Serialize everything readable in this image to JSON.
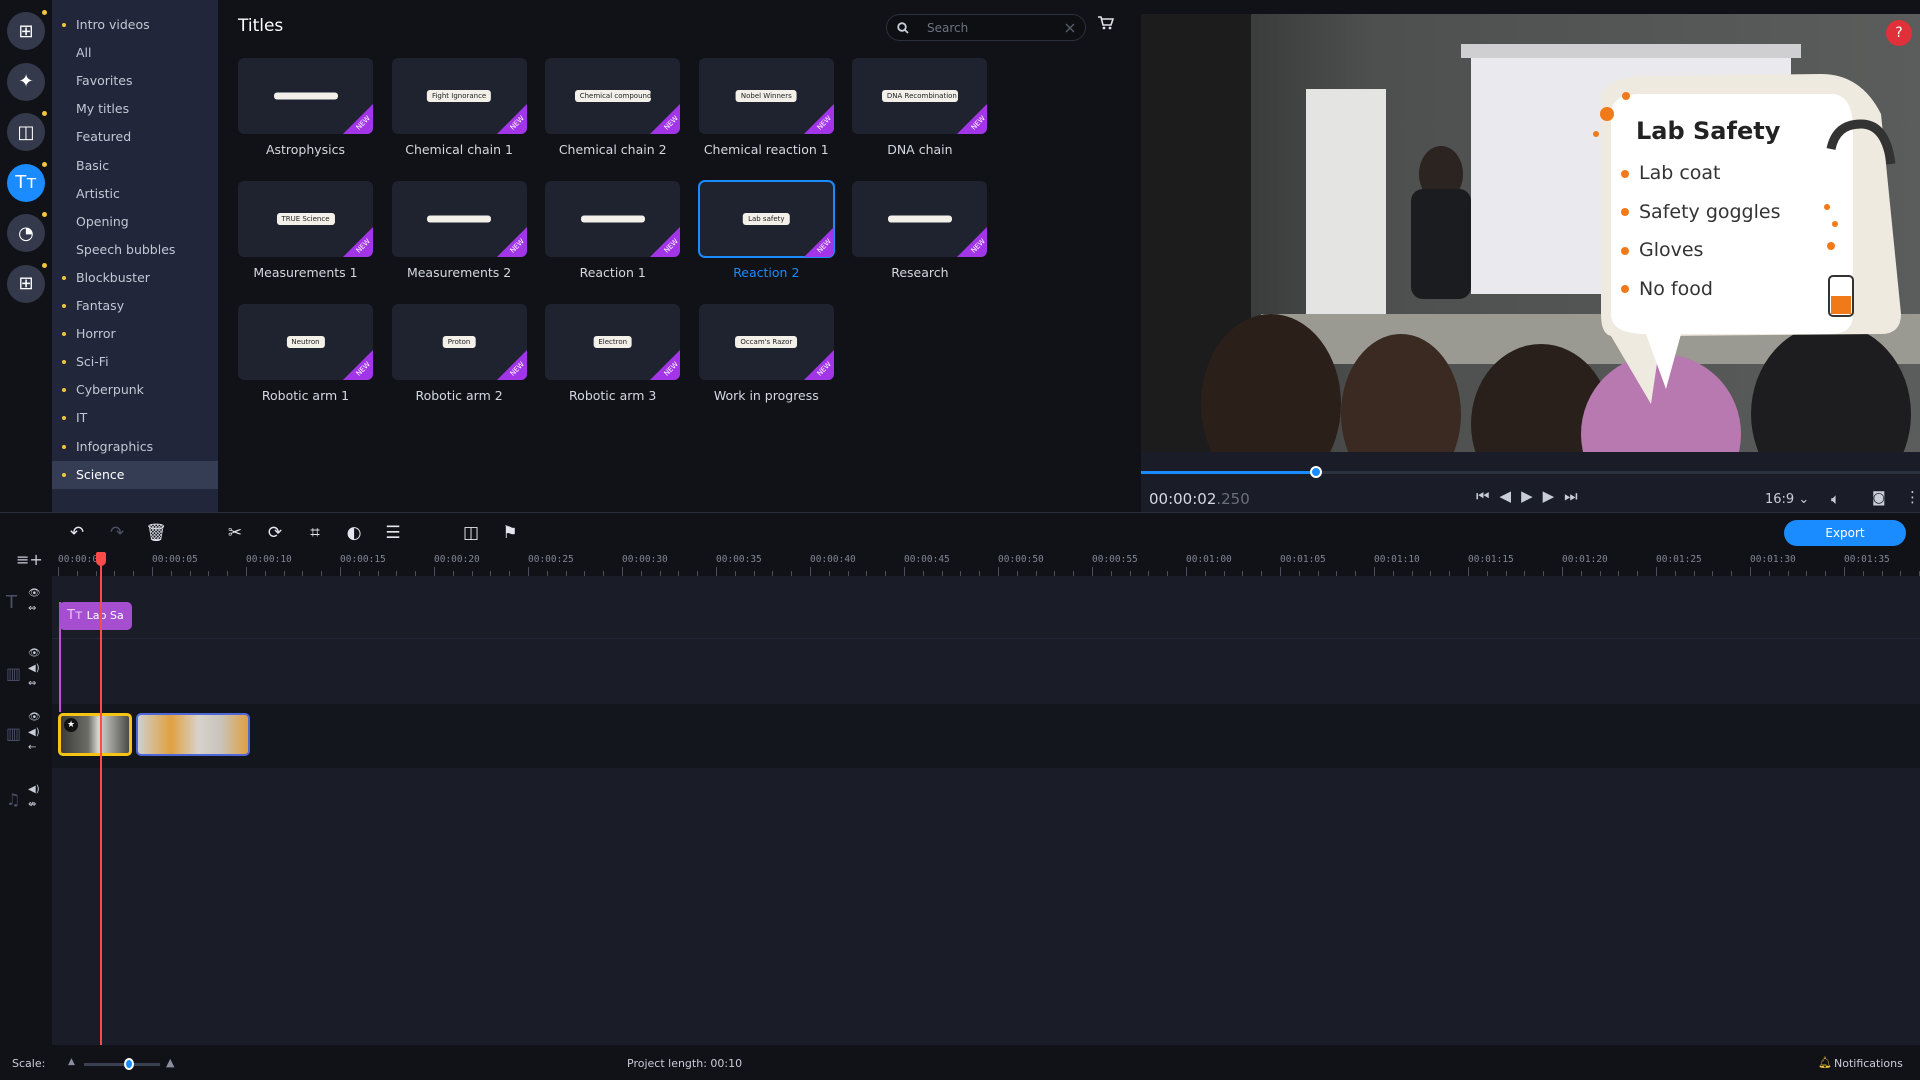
{
  "rail": [
    {
      "icon": "import-icon",
      "glyph": "⊞",
      "dot": true
    },
    {
      "icon": "magic-wand-icon",
      "glyph": "✦",
      "dot": false
    },
    {
      "icon": "transitions-icon",
      "glyph": "◫",
      "dot": true
    },
    {
      "icon": "titles-icon",
      "glyph": "Tт",
      "dot": true,
      "active": true
    },
    {
      "icon": "stickers-icon",
      "glyph": "◔",
      "dot": true
    },
    {
      "icon": "more-tools-icon",
      "glyph": "⊞",
      "dot": true
    }
  ],
  "categories": [
    {
      "label": "Intro videos",
      "dot": true
    },
    {
      "label": "All"
    },
    {
      "label": "Favorites"
    },
    {
      "label": "My titles"
    },
    {
      "label": "Featured"
    },
    {
      "label": "Basic"
    },
    {
      "label": "Artistic"
    },
    {
      "label": "Opening"
    },
    {
      "label": "Speech bubbles"
    },
    {
      "label": "Blockbuster",
      "dot": true
    },
    {
      "label": "Fantasy",
      "dot": true
    },
    {
      "label": "Horror",
      "dot": true
    },
    {
      "label": "Sci-Fi",
      "dot": true
    },
    {
      "label": "Cyberpunk",
      "dot": true
    },
    {
      "label": "IT",
      "dot": true
    },
    {
      "label": "Infographics",
      "dot": true
    },
    {
      "label": "Science",
      "dot": true,
      "selected": true
    }
  ],
  "panel": {
    "title": "Titles",
    "search_placeholder": "Search",
    "badge": "NEW"
  },
  "titles": [
    {
      "name": "Astrophysics",
      "thumb": "",
      "new": true
    },
    {
      "name": "Chemical chain 1",
      "thumb": "Fight Ignorance",
      "new": true
    },
    {
      "name": "Chemical chain 2",
      "thumb": "Chemical compounds",
      "new": true
    },
    {
      "name": "Chemical reaction 1",
      "thumb": "Nobel Winners",
      "new": true
    },
    {
      "name": "DNA chain",
      "thumb": "DNA Recombination",
      "new": true
    },
    {
      "name": "Measurements 1",
      "thumb": "TRUE Science",
      "new": true
    },
    {
      "name": "Measurements 2",
      "thumb": "",
      "new": true
    },
    {
      "name": "Reaction 1",
      "thumb": "",
      "new": true
    },
    {
      "name": "Reaction 2",
      "thumb": "Lab safety",
      "new": true,
      "selected": true
    },
    {
      "name": "Research",
      "thumb": "",
      "new": true
    },
    {
      "name": "Robotic arm 1",
      "thumb": "Neutron",
      "new": true
    },
    {
      "name": "Robotic arm 2",
      "thumb": "Proton",
      "new": true
    },
    {
      "name": "Robotic arm 3",
      "thumb": "Electron",
      "new": true
    },
    {
      "name": "Work in progress",
      "thumb": "Occam's Razor",
      "new": true
    }
  ],
  "preview": {
    "overlay_title": "Lab Safety",
    "items": [
      "Lab coat",
      "Safety goggles",
      "Gloves",
      "No food"
    ],
    "help": "?"
  },
  "player": {
    "time_main": "00:00:02",
    "time_ms": ".250",
    "progress": 0.225,
    "aspect": "16:9"
  },
  "toolbar": {
    "export_label": "Export"
  },
  "ruler": [
    "00:00:00",
    "00:00:05",
    "00:00:10",
    "00:00:15",
    "00:00:20",
    "00:00:25",
    "00:00:30",
    "00:00:35",
    "00:00:40",
    "00:00:45",
    "00:00:50",
    "00:00:55",
    "00:01:00",
    "00:01:05",
    "00:01:10",
    "00:01:15",
    "00:01:20",
    "00:01:25",
    "00:01:30",
    "00:01:35"
  ],
  "timeline": {
    "playhead_seconds": 2.25,
    "title_clip": "Lab Sa"
  },
  "status": {
    "scale_label": "Scale:",
    "project_length": "Project length:  00:10",
    "notifications": "Notifications"
  },
  "colors": {
    "accent": "#1a8cff",
    "new_badge": "#a335e8",
    "title_clip": "#a54fd0",
    "playhead": "#ff4a4a",
    "orange": "#f07a1a"
  }
}
